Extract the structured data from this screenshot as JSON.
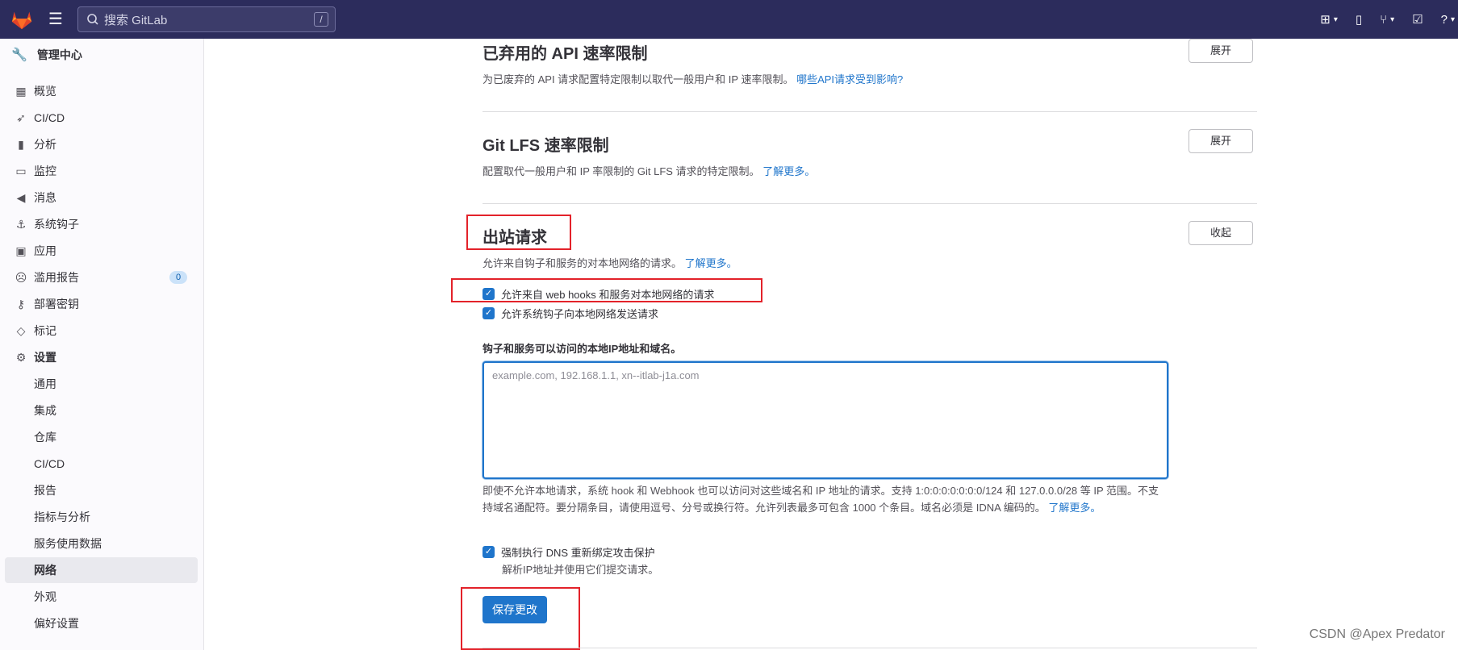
{
  "topbar": {
    "search_placeholder": "搜索 GitLab",
    "search_shortcut": "/"
  },
  "sidebar": {
    "admin_title": "管理中心",
    "items": [
      {
        "label": "概览",
        "icon": "overview-icon"
      },
      {
        "label": "CI/CD",
        "icon": "rocket-icon"
      },
      {
        "label": "分析",
        "icon": "chart-icon"
      },
      {
        "label": "监控",
        "icon": "monitor-icon"
      },
      {
        "label": "消息",
        "icon": "megaphone-icon"
      },
      {
        "label": "系统钩子",
        "icon": "anchor-icon"
      },
      {
        "label": "应用",
        "icon": "apps-icon"
      },
      {
        "label": "滥用报告",
        "icon": "frown-icon",
        "badge": "0"
      },
      {
        "label": "部署密钥",
        "icon": "key-icon"
      },
      {
        "label": "标记",
        "icon": "tag-icon"
      },
      {
        "label": "设置",
        "icon": "gear-icon"
      }
    ],
    "sub_items": [
      "通用",
      "集成",
      "仓库",
      "CI/CD",
      "报告",
      "指标与分析",
      "服务使用数据",
      "网络",
      "外观",
      "偏好设置"
    ],
    "active_sub": "网络"
  },
  "sections": {
    "deprecated": {
      "title": "已弃用的 API 速率限制",
      "desc": "为已废弃的 API 请求配置特定限制以取代一般用户和 IP 速率限制。",
      "link": "哪些API请求受到影响?",
      "button": "展开"
    },
    "lfs": {
      "title": "Git LFS 速率限制",
      "desc": "配置取代一般用户和 IP 率限制的 Git LFS 请求的特定限制。",
      "link": "了解更多。",
      "button": "展开"
    },
    "outbound": {
      "title": "出站请求",
      "desc": "允许来自钩子和服务的对本地网络的请求。",
      "link": "了解更多。",
      "button": "收起",
      "check_webhooks": "允许来自 web hooks 和服务对本地网络的请求",
      "check_system_hooks": "允许系统钩子向本地网络发送请求",
      "allowlist_label": "钩子和服务可以访问的本地IP地址和域名。",
      "allowlist_placeholder": "example.com, 192.168.1.1, xn--itlab-j1a.com",
      "help_text": "即使不允许本地请求，系统 hook 和 Webhook 也可以访问对这些域名和 IP 地址的请求。支持 1:0:0:0:0:0:0:0/124 和 127.0.0.0/28 等 IP 范围。不支持域名通配符。要分隔条目，请使用逗号、分号或换行符。允许列表最多可包含 1000 个条目。域名必须是 IDNA 编码的。",
      "help_link": "了解更多。",
      "dns_check": "强制执行 DNS 重新绑定攻击保护",
      "dns_help": "解析IP地址并使用它们提交请求。",
      "save_button": "保存更改"
    }
  },
  "watermark": "CSDN @Apex   Predator",
  "colors": {
    "topbar": "#2c2c5c",
    "accent": "#1f75cb",
    "annotation_red": "#e3222a"
  }
}
